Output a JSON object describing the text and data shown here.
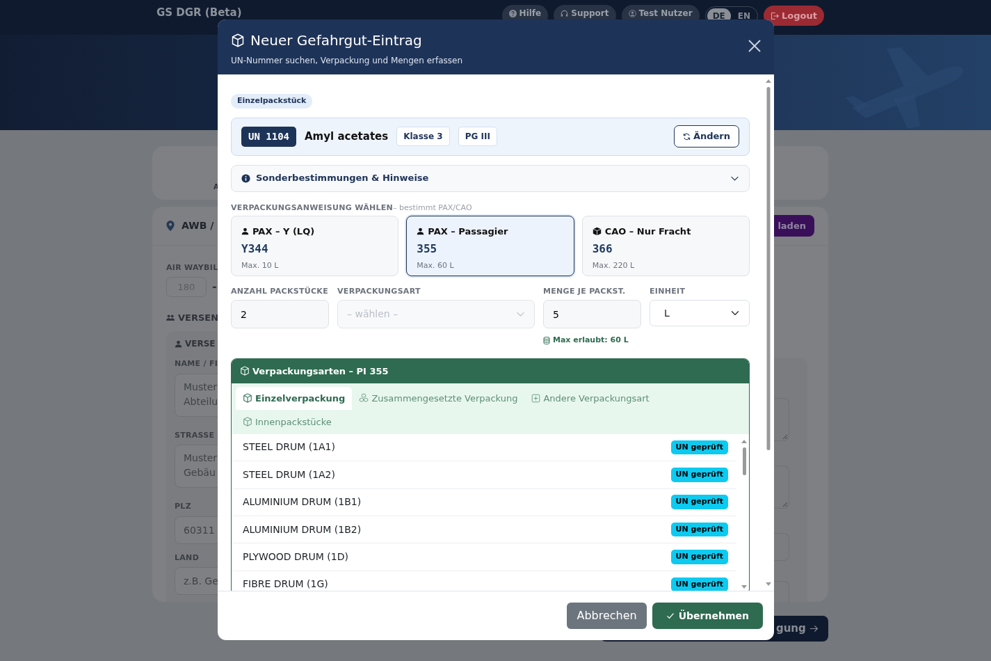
{
  "app": {
    "brand": "GS DGR (Beta)",
    "nav": [
      {
        "label": "Hilfe",
        "kind": "help"
      },
      {
        "label": "Support",
        "kind": "support"
      },
      {
        "label": "Test Nutzer",
        "kind": "user"
      }
    ],
    "languages": [
      {
        "label": "DE",
        "selected": true
      },
      {
        "label": "EN",
        "selected": false
      }
    ],
    "logout": "Logout"
  },
  "background": {
    "step_label": "A",
    "section_title": "AWB /",
    "load_button": "laden",
    "awb_label": "AIR WAYBIL",
    "awb_prefix": "180",
    "awb_separator": "-",
    "shipper_section": "VERSEN",
    "shipper_title": "VERSE",
    "fields": [
      {
        "label": "NAME / FI",
        "kind": "textarea",
        "placeholder": "Muster\nAbteilu"
      },
      {
        "label": "STRASSE",
        "kind": "textarea",
        "placeholder": "Muster\nGebäu"
      },
      {
        "label": "PLZ",
        "kind": "input",
        "placeholder": "60311"
      },
      {
        "label": "LAND",
        "kind": "input",
        "placeholder": "z.B. Ge"
      }
    ],
    "next_button": "gung"
  },
  "modal": {
    "title": "Neuer Gefahrgut-Eintrag",
    "subtitle": "UN-Nummer suchen, Verpackung und Mengen erfassen",
    "mode_badge": "Einzelpackstück",
    "substance": {
      "un": "UN 1104",
      "name": "Amyl acetates",
      "tags": [
        "Klasse 3",
        "PG III"
      ],
      "change_button": "Ändern"
    },
    "notes": {
      "title": "Sonderbestimmungen & Hinweise",
      "expanded": false
    },
    "instructions": {
      "label": "VERPACKUNGSANWEISUNG WÄHLEN",
      "hint": "– bestimmt PAX/CAO",
      "options": [
        {
          "kind": "passenger",
          "title": "PAX – Y (LQ)",
          "code": "Y344",
          "max": "Max. 10 L",
          "selected": false
        },
        {
          "kind": "passenger",
          "title": "PAX – Passagier",
          "code": "355",
          "max": "Max. 60 L",
          "selected": true
        },
        {
          "kind": "cargo",
          "title": "CAO – Nur Fracht",
          "code": "366",
          "max": "Max. 220 L",
          "selected": false
        }
      ]
    },
    "fields": [
      {
        "label": "ANZAHL PACKSTÜCKE",
        "kind": "input",
        "value": "2"
      },
      {
        "label": "VERPACKUNGSART",
        "kind": "select",
        "placeholder": "– wählen –",
        "disabled": true
      },
      {
        "label": "MENGE JE PACKST.",
        "kind": "input",
        "value": "5",
        "hint": "Max erlaubt: 60 L"
      },
      {
        "label": "EINHEIT",
        "kind": "native-select",
        "value": "L"
      }
    ],
    "packaging": {
      "title": "Verpackungsarten – PI 355",
      "tabs": [
        {
          "label": "Einzelverpackung",
          "kind": "single",
          "selected": true
        },
        {
          "label": "Zusammengesetzte Verpackung",
          "kind": "combination",
          "selected": false
        },
        {
          "label": "Andere Verpackungsart",
          "kind": "other",
          "selected": false
        },
        {
          "label": "Innenpackstücke",
          "kind": "single",
          "selected": false
        }
      ],
      "items": [
        {
          "name": "STEEL DRUM (1A1)",
          "badge": "UN geprüft"
        },
        {
          "name": "STEEL DRUM (1A2)",
          "badge": "UN geprüft"
        },
        {
          "name": "ALUMINIUM DRUM (1B1)",
          "badge": "UN geprüft"
        },
        {
          "name": "ALUMINIUM DRUM (1B2)",
          "badge": "UN geprüft"
        },
        {
          "name": "PLYWOOD DRUM (1D)",
          "badge": "UN geprüft"
        },
        {
          "name": "FIBRE DRUM (1G)",
          "badge": "UN geprüft"
        }
      ]
    },
    "buttons": {
      "cancel": "Abbrechen",
      "confirm": "Übernehmen"
    }
  }
}
